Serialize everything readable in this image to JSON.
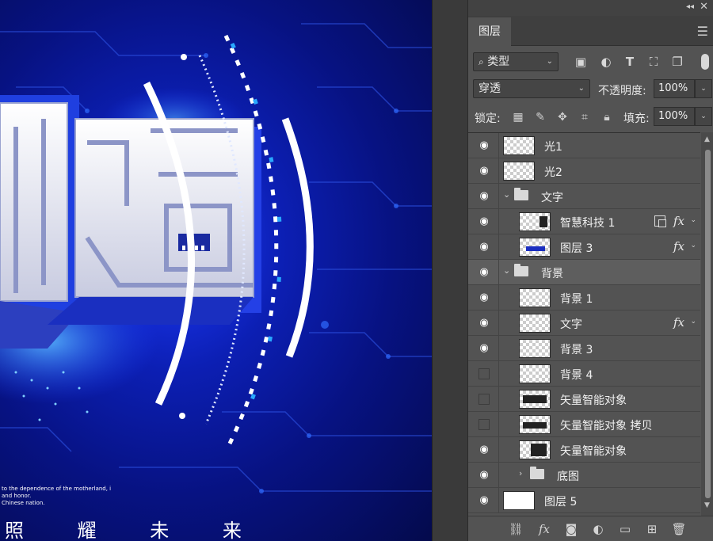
{
  "canvas": {
    "title_fragment": "创造",
    "small_text": [
      "to the dependence of the motherland, i",
      "and honor.",
      "Chinese nation."
    ],
    "slogan": "照 耀 未 来",
    "colors": {
      "bg_dark": "#040a4c",
      "bg_mid": "#0c1fb4",
      "accent": "#29a8ff"
    }
  },
  "panel": {
    "collapse_icon": "collapse-icon",
    "close_icon": "close-icon",
    "tab": "图层",
    "menu_icon": "menu-icon",
    "filter": {
      "label": "类型",
      "search_icon": "search-icon",
      "icons": [
        "image-filter-icon",
        "adjustment-filter-icon",
        "type-filter-icon",
        "shape-filter-icon",
        "smartobject-filter-icon"
      ]
    },
    "blend_mode": "穿透",
    "opacity_label": "不透明度:",
    "opacity_value": "100%",
    "lock_label": "锁定:",
    "lock_icons": [
      "lock-transparent-icon",
      "lock-pixels-icon",
      "lock-position-icon",
      "lock-artboard-icon",
      "lock-all-icon"
    ],
    "fill_label": "填充:",
    "fill_value": "100%",
    "layers": [
      {
        "name": "光1",
        "visible": true,
        "indent": 0,
        "type": "layer"
      },
      {
        "name": "光2",
        "visible": true,
        "indent": 0,
        "type": "layer"
      },
      {
        "name": "文字",
        "visible": true,
        "indent": 0,
        "type": "group",
        "expanded": true
      },
      {
        "name": "智慧科技 1",
        "visible": true,
        "indent": 1,
        "type": "smart",
        "fx": true,
        "linked": true
      },
      {
        "name": "图层 3",
        "visible": true,
        "indent": 1,
        "type": "layer",
        "fx": true
      },
      {
        "name": "背景",
        "visible": true,
        "indent": 0,
        "type": "group",
        "expanded": true,
        "selected": true
      },
      {
        "name": "背景 1",
        "visible": true,
        "indent": 1,
        "type": "layer"
      },
      {
        "name": "文字",
        "visible": true,
        "indent": 1,
        "type": "layer",
        "fx": true
      },
      {
        "name": "背景 3",
        "visible": true,
        "indent": 1,
        "type": "layer"
      },
      {
        "name": "背景 4",
        "visible": false,
        "indent": 1,
        "type": "layer"
      },
      {
        "name": "矢量智能对象",
        "visible": false,
        "indent": 1,
        "type": "smart"
      },
      {
        "name": "矢量智能对象 拷贝",
        "visible": false,
        "indent": 1,
        "type": "smart"
      },
      {
        "name": "矢量智能对象",
        "visible": true,
        "indent": 1,
        "type": "smart"
      },
      {
        "name": "底图",
        "visible": true,
        "indent": 1,
        "type": "group",
        "expanded": false
      },
      {
        "name": "图层 5",
        "visible": true,
        "indent": 0,
        "type": "white"
      }
    ],
    "footer_icons": [
      "link-icon",
      "fx-icon",
      "mask-icon",
      "adjustment-icon",
      "folder-icon",
      "new-layer-icon",
      "trash-icon"
    ]
  }
}
